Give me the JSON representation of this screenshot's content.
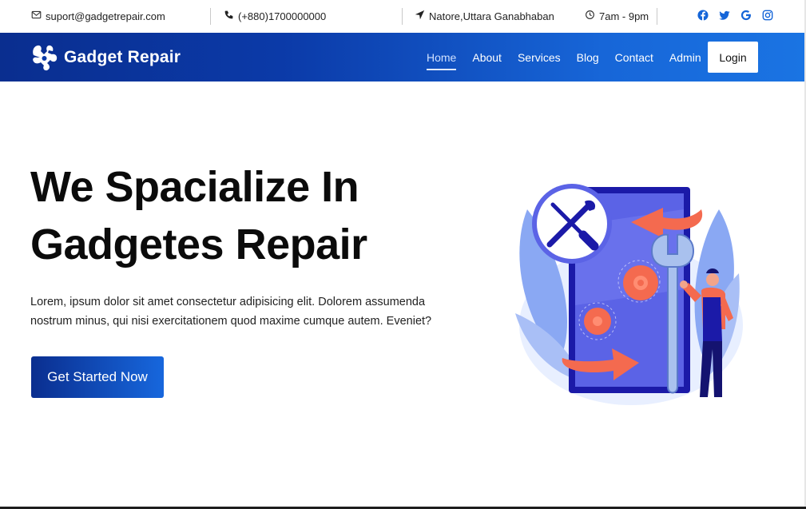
{
  "topbar": {
    "email": "suport@gadgetrepair.com",
    "phone": "(+880)1700000000",
    "address": "Natore,Uttara Ganabhaban",
    "hours": "7am - 9pm",
    "icons": {
      "email": "mail-icon",
      "phone": "phone-icon",
      "address": "location-arrow-icon",
      "hours": "clock-icon"
    },
    "social": [
      "facebook-icon",
      "twitter-icon",
      "google-icon",
      "instagram-icon"
    ],
    "social_color": "#1565d8"
  },
  "navbar": {
    "brand": "Gadget Repair",
    "links": [
      "Home",
      "About",
      "Services",
      "Blog",
      "Contact",
      "Admin"
    ],
    "active": "Home",
    "login": "Login",
    "gradient": [
      "#0a2e8f",
      "#1a74e3"
    ]
  },
  "hero": {
    "title_line1": "We Spacialize In",
    "title_line2": "Gadgetes Repair",
    "text": "Lorem, ipsum dolor sit amet consectetur adipisicing elit. Dolorem assumenda nostrum minus, qui nisi exercitationem quod maxime cumque autem. Eveniet?",
    "cta": "Get Started Now",
    "illustration": "phone-repair-illustration"
  }
}
